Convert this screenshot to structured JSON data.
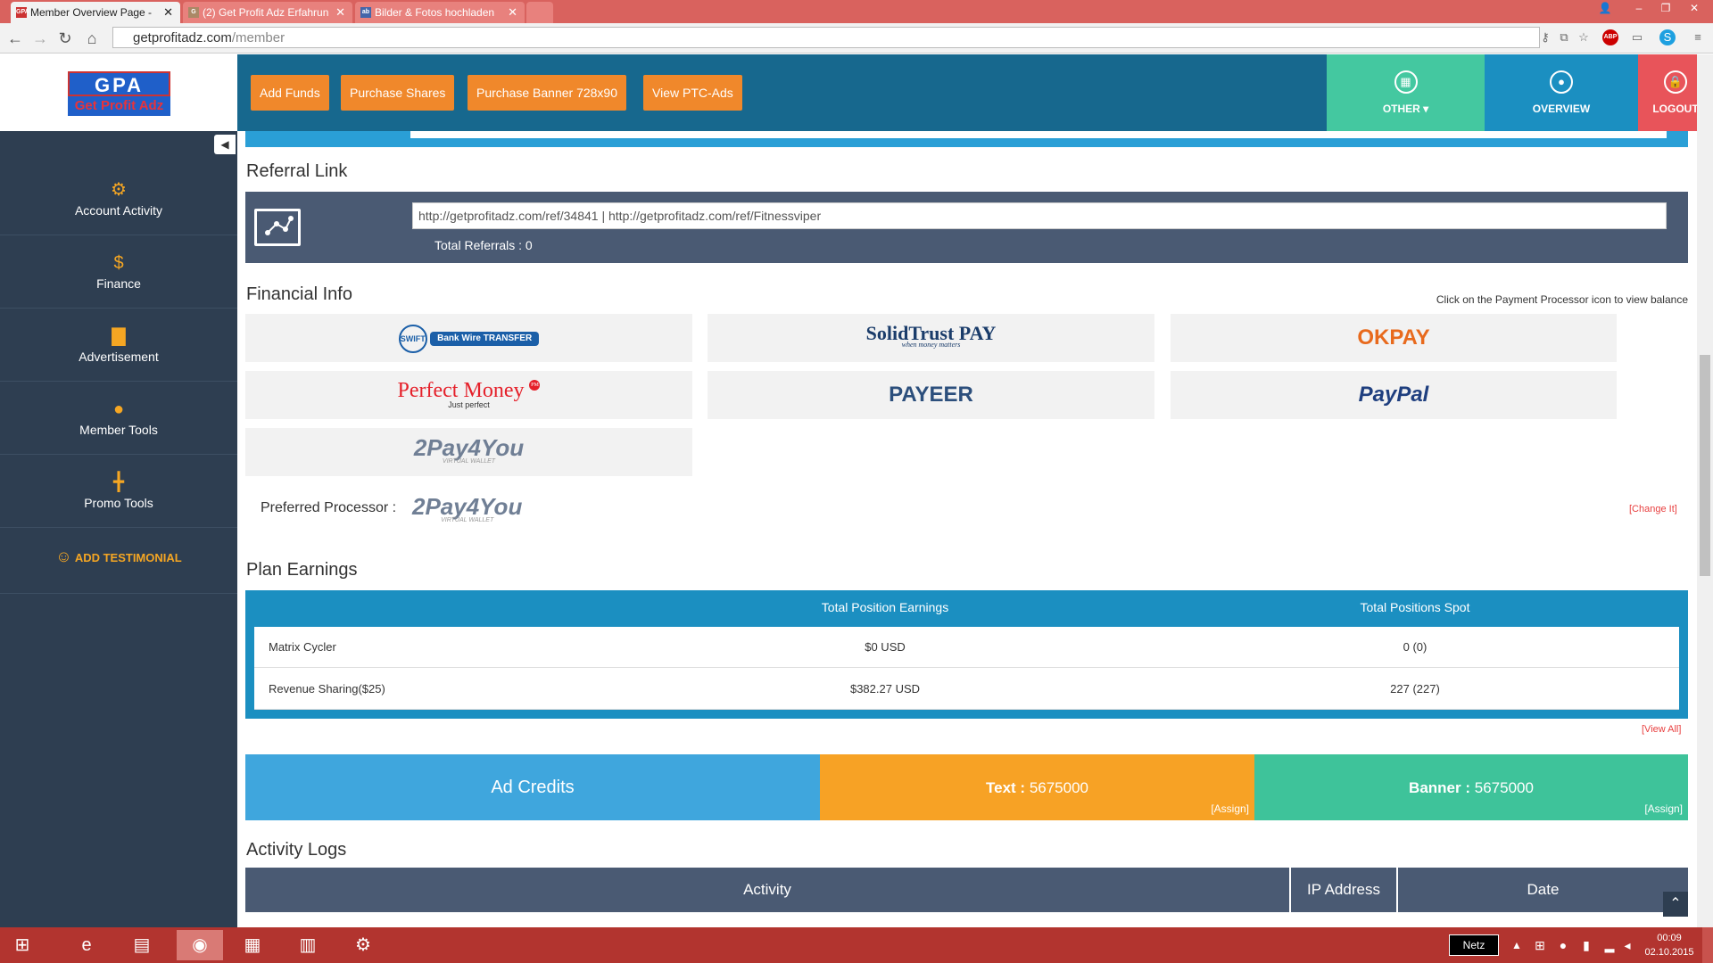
{
  "browser": {
    "tabs": [
      {
        "title": "Member Overview Page -",
        "fav": "GPA"
      },
      {
        "title": "(2) Get Profit Adz Erfahrun",
        "fav": "G"
      },
      {
        "title": "Bilder & Fotos hochladen",
        "fav": "ab"
      }
    ],
    "url_host": "getprofitadz.com",
    "url_path": "/member",
    "abp_badge": "ABP"
  },
  "header": {
    "logo_top": "GPA",
    "logo_bottom": "Get Profit Adz",
    "buttons": [
      "Add Funds",
      "Purchase Shares",
      "Purchase Banner 728x90",
      "View PTC-Ads"
    ],
    "other": "OTHER",
    "overview": "OVERVIEW",
    "logout": "LOGOUT"
  },
  "sidebar": {
    "items": [
      {
        "label": "Account Activity",
        "icon": "gear-icon"
      },
      {
        "label": "Finance",
        "icon": "dollar-icon"
      },
      {
        "label": "Advertisement",
        "icon": "file-icon"
      },
      {
        "label": "Member Tools",
        "icon": "user-icon"
      },
      {
        "label": "Promo Tools",
        "icon": "promo-icon"
      }
    ],
    "testimonial": "ADD TESTIMONIAL"
  },
  "referral": {
    "title": "Referral Link",
    "link_id": "http://getprofitadz.com/ref/34841",
    "separator": "|",
    "link_name": "http://getprofitadz.com/ref/Fitnessviper",
    "total_label": "Total Referrals : 0"
  },
  "financial": {
    "title": "Financial Info",
    "hint": "Click on the Payment Processor icon to view balance",
    "processors": [
      "Bank Wire TRANSFER",
      "SolidTrust PAY",
      "OKPAY",
      "Perfect Money",
      "PAYEER",
      "PayPal",
      "2Pay4You"
    ],
    "swift": "SWIFT",
    "solidtrust_tag": "when money matters",
    "perfect_money_tag": "Just perfect",
    "pm_badge": "PM",
    "twopay_tag": "VIRTUAL WALLET",
    "preferred_label": "Preferred Processor :",
    "preferred": "2Pay4You",
    "change": "[Change It]"
  },
  "plan": {
    "title": "Plan Earnings",
    "headers": [
      "Total Position Earnings",
      "Total Positions Spot"
    ],
    "rows": [
      {
        "name": "Matrix Cycler",
        "earnings": "$0 USD",
        "spot": "0 (0)"
      },
      {
        "name": "Revenue Sharing($25)",
        "earnings": "$382.27 USD",
        "spot": "227 (227)"
      }
    ],
    "view_all": "[View All]"
  },
  "credits": {
    "title": "Ad Credits",
    "text_label": "Text :",
    "text_value": "5675000",
    "banner_label": "Banner :",
    "banner_value": "5675000",
    "assign": "[Assign]"
  },
  "activity": {
    "title": "Activity Logs",
    "headers": [
      "Activity",
      "IP Address",
      "Date"
    ]
  },
  "taskbar": {
    "network": "Netz",
    "time": "00:09",
    "date": "02.10.2015"
  },
  "colors": {
    "topnav": "#17688e",
    "orange": "#f0882b",
    "sidebar": "#2e3e51",
    "teal": "#44c8a0",
    "blue": "#1b8fc1",
    "red": "#e8545a"
  }
}
